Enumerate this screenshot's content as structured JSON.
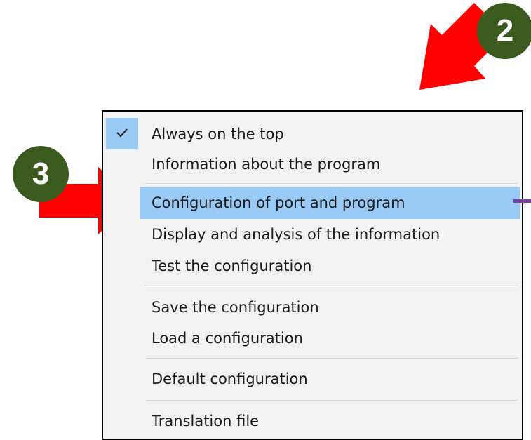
{
  "annotations": {
    "badge_2": "2",
    "badge_3": "3"
  },
  "colors": {
    "badge": "#3b5a1e",
    "arrow": "#ff0000",
    "highlight": "#99c9f5",
    "menu_bg": "#f2f2f2",
    "submenu_marker": "#7b3fa6"
  },
  "menu": {
    "items": [
      {
        "label": "Always on the top",
        "checked": true,
        "icon": "check-icon"
      },
      {
        "label": "Information about the program"
      },
      {
        "label": "Configuration of port and program",
        "highlighted": true
      },
      {
        "label": "Display and analysis of the information"
      },
      {
        "label": "Test the configuration"
      },
      {
        "label": "Save the configuration"
      },
      {
        "label": "Load a configuration"
      },
      {
        "label": "Default configuration"
      },
      {
        "label": "Translation file"
      }
    ]
  }
}
